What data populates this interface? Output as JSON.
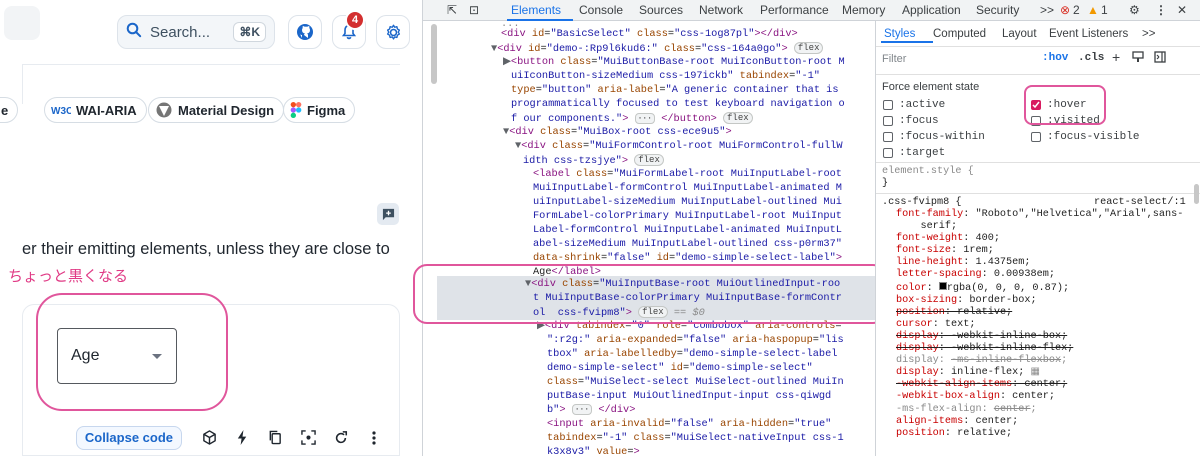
{
  "page": {
    "search_label": "Search...",
    "search_shortcut": "⌘K",
    "notification_count": "4",
    "tags": [
      {
        "label": "e",
        "icon": "document-icon"
      },
      {
        "label": "WAI-ARIA",
        "icon": "w3c-icon"
      },
      {
        "label": "Material Design",
        "icon": "material-design-icon"
      },
      {
        "label": "Figma",
        "icon": "figma-icon"
      }
    ],
    "body_text": "er their emitting elements, unless they are close to",
    "annotation_jp": "ちょっと黒くなる",
    "select_value": "Age",
    "collapse_label": "Collapse code",
    "accent_pink": "#e0569c",
    "accent_blue": "#1b66c9"
  },
  "devtools": {
    "tabs": [
      "Elements",
      "Console",
      "Sources",
      "Network",
      "Performance",
      "Memory",
      "Application",
      "Security",
      ">>"
    ],
    "active_tab": "Elements",
    "error_count": "2",
    "warning_count": "1",
    "styles_tabs": [
      "Styles",
      "Computed",
      "Layout",
      "Event Listeners",
      ">>"
    ],
    "filter_placeholder": "Filter",
    "hov_label": ":hov",
    "cls_label": ".cls",
    "force_state_title": "Force element state",
    "states": [
      {
        "label": ":active",
        "checked": false
      },
      {
        "label": ":hover",
        "checked": true
      },
      {
        "label": ":focus",
        "checked": false
      },
      {
        "label": ":visited",
        "checked": false
      },
      {
        "label": ":focus-within",
        "checked": false
      },
      {
        "label": ":focus-visible",
        "checked": false
      },
      {
        "label": ":target",
        "checked": false
      }
    ],
    "element_style": "element.style {",
    "element_style_close": "}",
    "rule_selector": ".css-fvipm8 {",
    "rule_source": "react-select/:1",
    "flex_pill": "flex",
    "eq_label": "== $0"
  }
}
